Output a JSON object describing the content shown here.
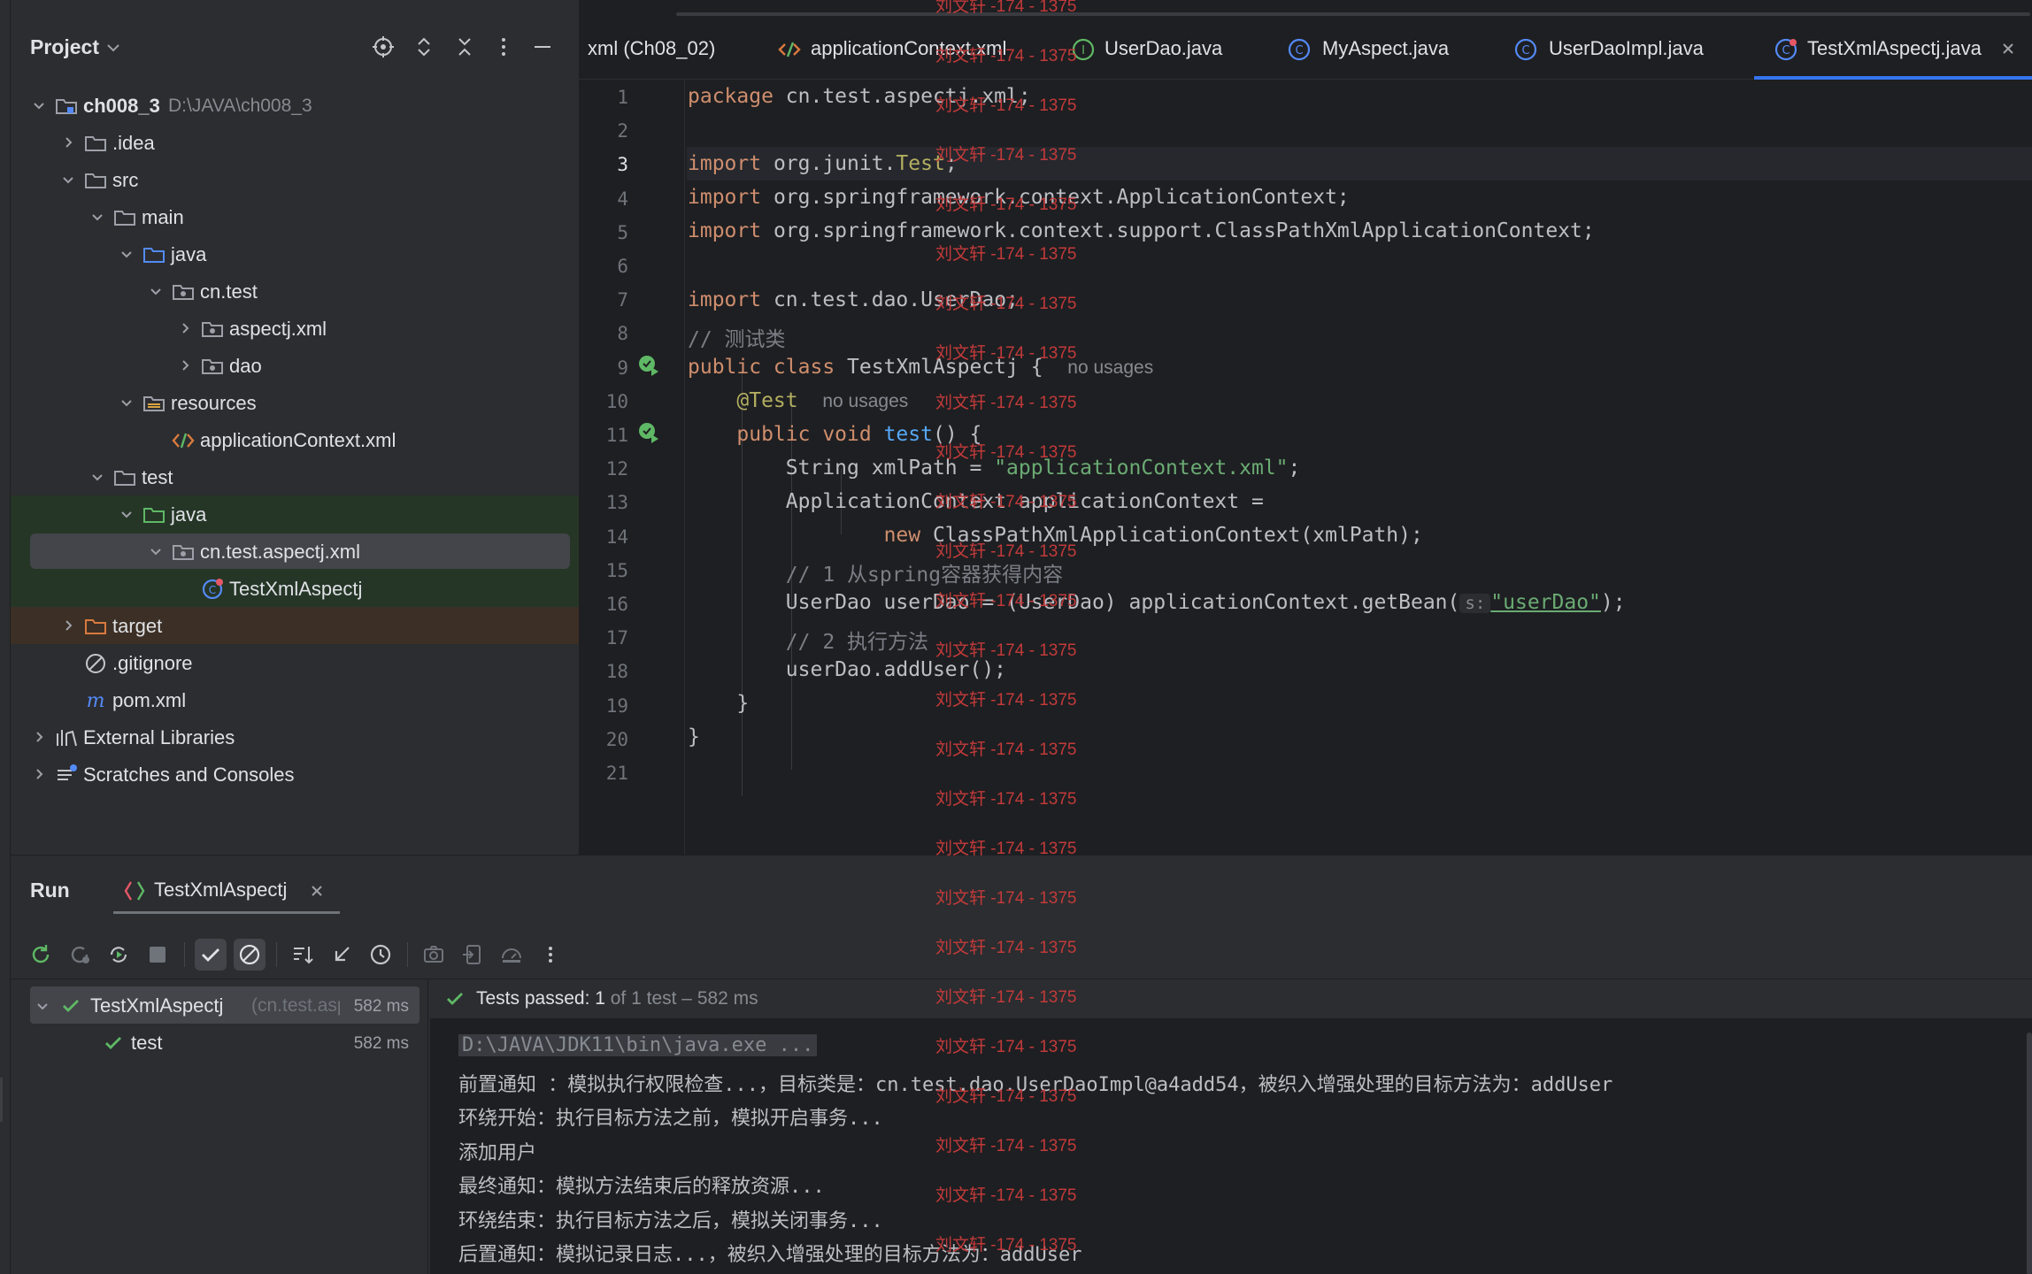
{
  "project_panel": {
    "title": "Project",
    "tree": [
      {
        "label": "ch008_3",
        "hint": "D:\\JAVA\\ch008_3",
        "expanded": true,
        "icon": "module-folder-icon"
      },
      {
        "label": ".idea",
        "expanded": false,
        "icon": "folder-icon"
      },
      {
        "label": "src",
        "expanded": true,
        "icon": "folder-icon"
      },
      {
        "label": "main",
        "expanded": true,
        "icon": "folder-icon"
      },
      {
        "label": "java",
        "expanded": true,
        "icon": "source-folder-icon"
      },
      {
        "label": "cn.test",
        "expanded": true,
        "icon": "package-icon"
      },
      {
        "label": "aspectj.xml",
        "expanded": false,
        "icon": "package-icon"
      },
      {
        "label": "dao",
        "expanded": false,
        "icon": "package-icon"
      },
      {
        "label": "resources",
        "expanded": true,
        "icon": "resources-folder-icon"
      },
      {
        "label": "applicationContext.xml",
        "icon": "xml-file-icon"
      },
      {
        "label": "test",
        "expanded": true,
        "icon": "folder-icon"
      },
      {
        "label": "java",
        "expanded": true,
        "icon": "test-source-folder-icon"
      },
      {
        "label": "cn.test.aspectj.xml",
        "expanded": true,
        "icon": "package-icon"
      },
      {
        "label": "TestXmlAspectj",
        "icon": "test-class-icon"
      },
      {
        "label": "target",
        "expanded": false,
        "icon": "excluded-folder-icon"
      },
      {
        "label": ".gitignore",
        "icon": "ignore-file-icon"
      },
      {
        "label": "pom.xml",
        "icon": "maven-icon"
      },
      {
        "label": "External Libraries",
        "expanded": false,
        "icon": "libraries-icon"
      },
      {
        "label": "Scratches and Consoles",
        "expanded": false,
        "icon": "scratches-icon"
      }
    ]
  },
  "tabs": [
    {
      "label": "xml (Ch08_02)",
      "icon": ""
    },
    {
      "label": "applicationContext.xml",
      "icon": "xml-file-icon"
    },
    {
      "label": "UserDao.java",
      "icon": "interface-icon"
    },
    {
      "label": "MyAspect.java",
      "icon": "class-icon"
    },
    {
      "label": "UserDaoImpl.java",
      "icon": "class-icon"
    },
    {
      "label": "TestXmlAspectj.java",
      "icon": "test-class-icon",
      "active": true
    }
  ],
  "editor": {
    "current_line": 3,
    "line_numbers": [
      "1",
      "2",
      "3",
      "4",
      "5",
      "6",
      "7",
      "8",
      "9",
      "10",
      "11",
      "12",
      "13",
      "14",
      "15",
      "16",
      "17",
      "18",
      "19",
      "20",
      "21"
    ],
    "code": {
      "l1_kw": "package",
      "l1_rest": " cn.test.aspectj.xml;",
      "l3_kw": "import",
      "l3_a": " org.junit.",
      "l3_ann": "Test",
      "l3_end": ";",
      "l4_kw": "import",
      "l4_rest": " org.springframework.context.ApplicationContext;",
      "l5_kw": "import",
      "l5_rest": " org.springframework.context.support.ClassPathXmlApplicationContext;",
      "l7_kw": "import",
      "l7_rest": " cn.test.dao.UserDao;",
      "l8_cmt": "// 测试类",
      "l9_kw": "public class",
      "l9_rest": " TestXmlAspectj {",
      "l9_hint": "no usages",
      "l10_ann": "@Test",
      "l10_hint": "no usages",
      "l11_kw": "public void",
      "l11_fn": " test",
      "l11_rest": "() {",
      "l12_a": "String xmlPath = ",
      "l12_str": "\"applicationContext.xml\"",
      "l12_end": ";",
      "l13": "ApplicationContext applicationContext =",
      "l14_kw": "new",
      "l14_rest": " ClassPathXmlApplicationContext(xmlPath);",
      "l15_cmt": "// 1 从spring容器获得内容",
      "l16_a": "UserDao userDao = (UserDao) applicationContext.getBean(",
      "l16_hint": "s:",
      "l16_str": "\"userDao\"",
      "l16_end": ");",
      "l17_cmt": "// 2 执行方法",
      "l18": "userDao.addUser();",
      "l19": "}",
      "l20": "}"
    }
  },
  "run_panel": {
    "title": "Run",
    "tab_label": "TestXmlAspectj",
    "status_main": "Tests passed: 1",
    "status_rest": " of 1 test – 582 ms",
    "tree": {
      "root_label": "TestXmlAspectj",
      "root_pkg": "(cn.test.asp",
      "root_time": "582 ms",
      "child_label": "test",
      "child_time": "582 ms"
    },
    "console": [
      "D:\\JAVA\\JDK11\\bin\\java.exe ...",
      "前置通知 ：模拟执行权限检查...，目标类是：cn.test.dao.UserDaoImpl@a4add54，被织入增强处理的目标方法为：addUser",
      "环绕开始：执行目标方法之前，模拟开启事务...",
      "添加用户",
      "最终通知：模拟方法结束后的释放资源...",
      "环绕结束：执行目标方法之后，模拟关闭事务...",
      "后置通知：模拟记录日志...，被织入增强处理的目标方法为：addUser"
    ]
  },
  "watermark_text": "刘文轩 -174 - 1375",
  "colors": {
    "accent": "#3574f0",
    "keyword": "#cf8e6d",
    "string": "#6aab73",
    "annotation": "#b3ae60",
    "function": "#56a8f5",
    "comment": "#7a7e85",
    "pass": "#5fb865",
    "watermark": "#c23a3a"
  }
}
